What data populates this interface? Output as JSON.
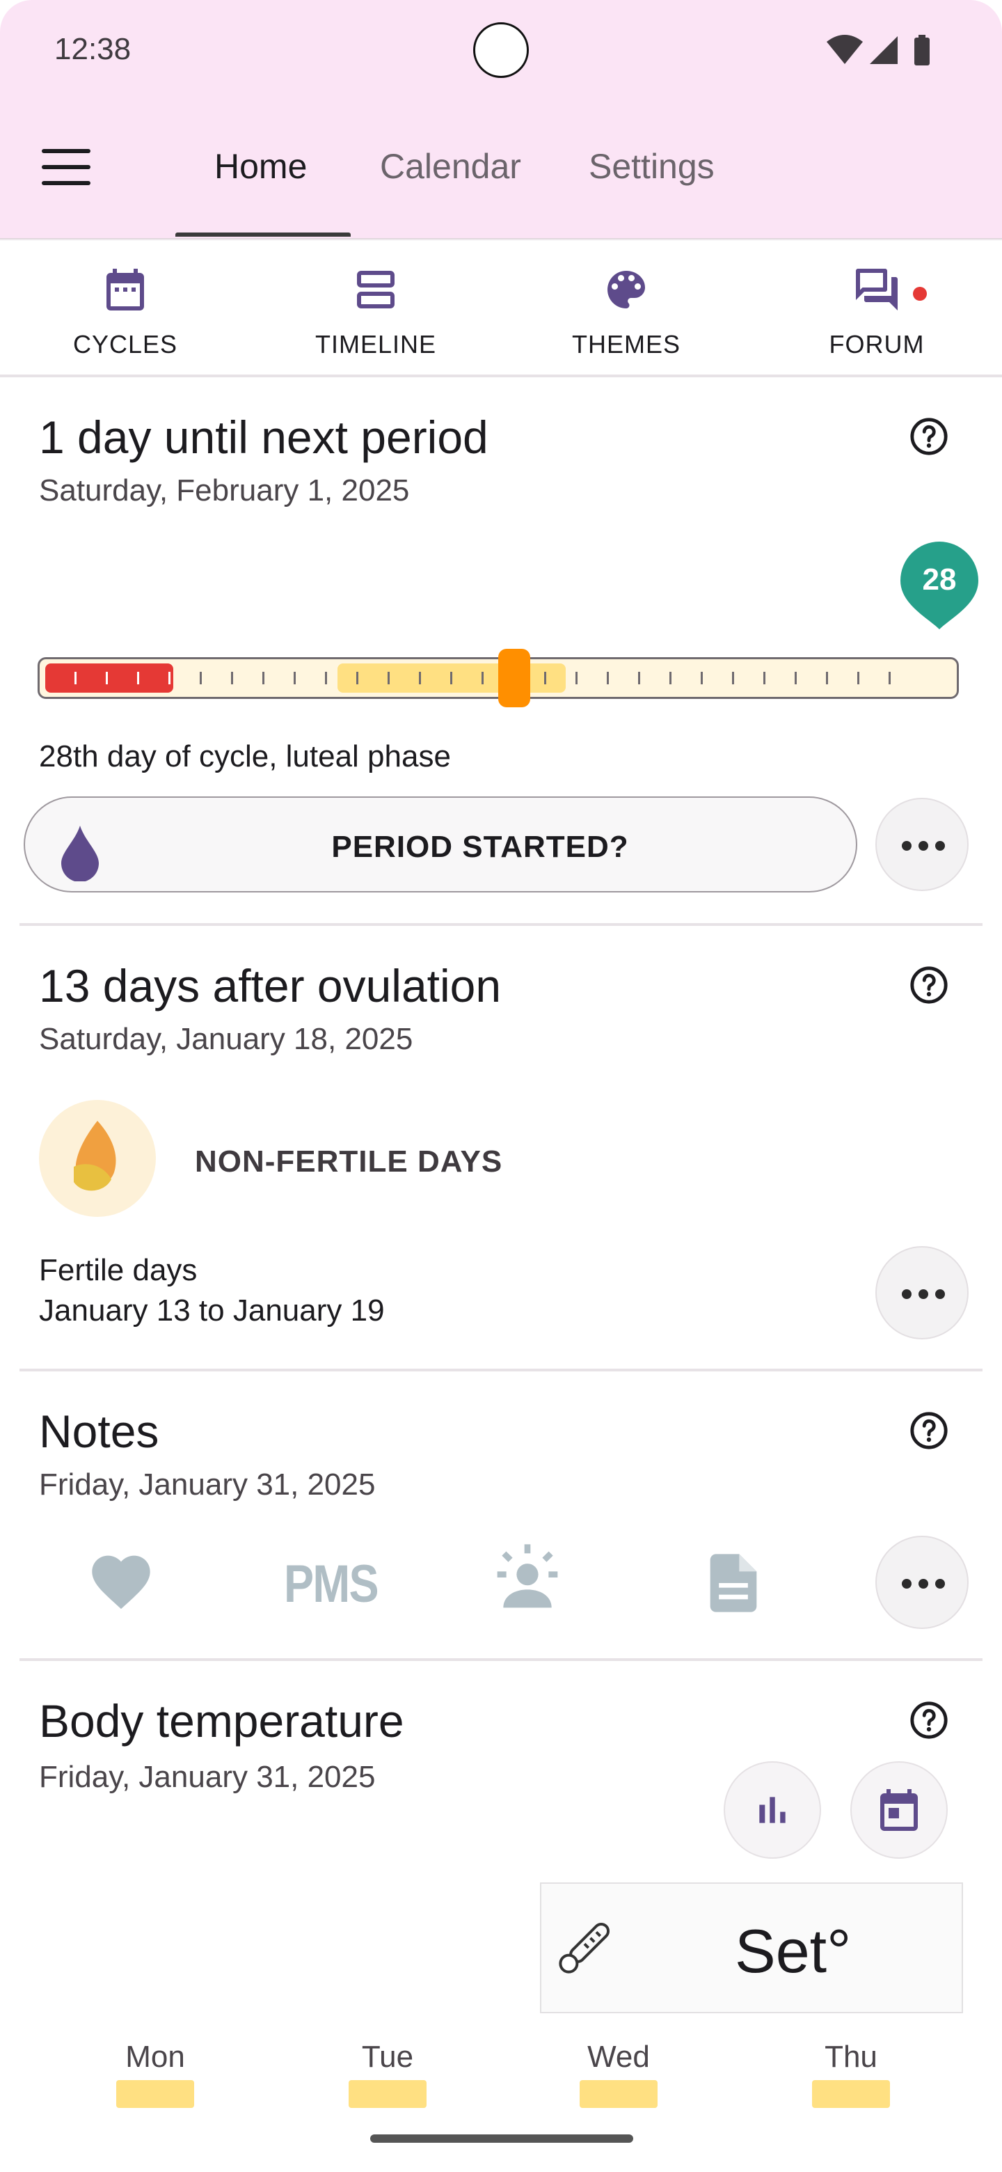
{
  "status": {
    "time": "12:38"
  },
  "tabs": [
    {
      "label": "Home",
      "active": true
    },
    {
      "label": "Calendar",
      "active": false
    },
    {
      "label": "Settings",
      "active": false
    }
  ],
  "quick_nav": [
    {
      "label": "CYCLES",
      "icon": "calendar-icon"
    },
    {
      "label": "TIMELINE",
      "icon": "view-agenda-icon"
    },
    {
      "label": "THEMES",
      "icon": "palette-icon"
    },
    {
      "label": "FORUM",
      "icon": "forum-icon"
    }
  ],
  "period_card": {
    "title": "1 day until next period",
    "date": "Saturday, February 1, 2025",
    "cycle_day": "28",
    "phase_text": "28th day of cycle, luteal phase",
    "button_label": "PERIOD STARTED?"
  },
  "ovulation_card": {
    "title": "13 days after ovulation",
    "date": "Saturday, January 18, 2025",
    "status_label": "NON-FERTILE DAYS",
    "fertile_title": "Fertile days",
    "fertile_range": "January 13 to January 19"
  },
  "notes_card": {
    "title": "Notes",
    "date": "Friday, January 31, 2025",
    "icons": [
      "heart-icon",
      "pms-icon",
      "mood-icon",
      "note-icon"
    ],
    "pms_text": "PMS"
  },
  "temperature_card": {
    "title": "Body temperature",
    "date": "Friday, January 31, 2025",
    "set_label": "Set°",
    "days": [
      "Mon",
      "Tue",
      "Wed",
      "Thu"
    ]
  },
  "colors": {
    "app_bar": "#fbe4f5",
    "accent_purple": "#5e4b8b",
    "period_red": "#e53935",
    "fertile_yellow": "#ffe082",
    "today_orange": "#ff8f00",
    "badge_teal": "#26a08a"
  }
}
